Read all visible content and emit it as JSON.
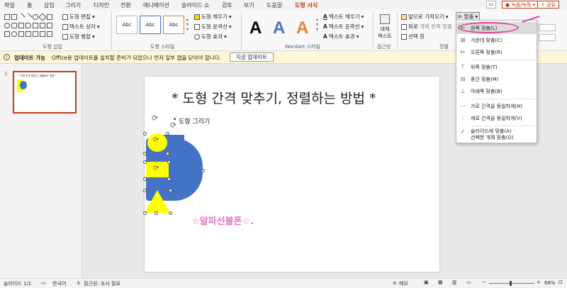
{
  "tabs": [
    {
      "label": "파일",
      "active": false
    },
    {
      "label": "홈",
      "active": false
    },
    {
      "label": "삽입",
      "active": false
    },
    {
      "label": "그리기",
      "active": false
    },
    {
      "label": "디자인",
      "active": false
    },
    {
      "label": "전환",
      "active": false
    },
    {
      "label": "애니메이션",
      "active": false
    },
    {
      "label": "슬라이드 쇼",
      "active": false
    },
    {
      "label": "검토",
      "active": false
    },
    {
      "label": "보기",
      "active": false
    },
    {
      "label": "도움말",
      "active": false
    },
    {
      "label": "도형 서식",
      "active": true
    }
  ],
  "titlebar_right": {
    "record": "녹음/녹화",
    "share": "공유"
  },
  "ribbon": {
    "insert_shapes": {
      "label": "도형 삽입",
      "edit_shape": "도형 편집",
      "text_box": "텍스트 상자",
      "merge_shapes": "도형 병합"
    },
    "shape_styles": {
      "label": "도형 스타일",
      "style_sample": "Abc",
      "fill": "도형 채우기",
      "outline": "도형 윤곽선",
      "effects": "도형 효과"
    },
    "wordart": {
      "label": "WordArt 스타일",
      "letter": "A",
      "text_fill": "텍스트 채우기",
      "text_outline": "텍스트 윤곽선",
      "text_effects": "텍스트 효과"
    },
    "accessibility": {
      "label": "접근성",
      "alt_text_line1": "대체",
      "alt_text_line2": "텍스트"
    },
    "arrange": {
      "label": "정렬",
      "bring_forward": "앞으로 가져오기",
      "send_backward": "뒤로",
      "selection_pane": "선택 창",
      "align": "맞춤",
      "partial_text": "개체 왼쪽 맞춤"
    }
  },
  "infobar": {
    "title": "업데이트 가능",
    "message": "Office용 업데이트를 설치할 준비가 되었으나 먼저 일부 앱을 닫아야 합니다.",
    "button": "지금 업데이트"
  },
  "thumbnail": {
    "number": "1",
    "title": "* 도형 간격 맞추기, 정렬하는 방법 *"
  },
  "slide": {
    "title": "* 도형 간격 맞추기, 정렬하는 방법 *",
    "bullet": "도형 그리기",
    "watermark": "☆알파선볼폰☆."
  },
  "align_menu": [
    {
      "label": "왼쪽 맞춤(L)",
      "icon": "align-left-icon",
      "highlighted": true
    },
    {
      "label": "가운데 맞춤(C)",
      "icon": "align-center-icon",
      "highlighted": false
    },
    {
      "label": "오른쪽 맞춤(R)",
      "icon": "align-right-icon",
      "highlighted": false
    },
    {
      "label": "위쪽 맞춤(T)",
      "icon": "align-top-icon",
      "highlighted": false
    },
    {
      "label": "중간 맞춤(M)",
      "icon": "align-middle-icon",
      "highlighted": false
    },
    {
      "label": "아래쪽 맞춤(B)",
      "icon": "align-bottom-icon",
      "highlighted": false
    },
    {
      "label": "가로 간격을 동일하게(H)",
      "icon": "distribute-horizontal-icon",
      "highlighted": false
    },
    {
      "label": "세로 간격을 동일하게(V)",
      "icon": "distribute-vertical-icon",
      "highlighted": false
    },
    {
      "label": "슬라이드에 맞춤(A)",
      "icon": "checkmark-icon",
      "highlighted": false
    },
    {
      "label": "선택한 개체 맞춤(O)",
      "icon": "",
      "highlighted": false
    }
  ],
  "statusbar": {
    "slide_info": "슬라이드 1/1",
    "language": "한국어",
    "accessibility": "접근성: 조사 필요",
    "notes": "메모",
    "zoom": "68%"
  },
  "colors": {
    "accent": "#c43e1c",
    "shape_blue": "#4472c4",
    "shape_yellow": "#ffff00",
    "watermark_pink": "#e377c2",
    "highlight_circle": "#e0409a"
  }
}
